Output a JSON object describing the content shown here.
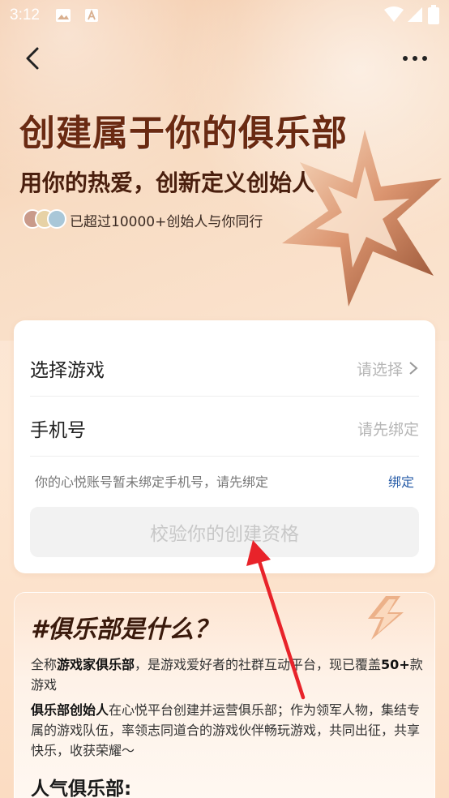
{
  "status_bar": {
    "time": "3:12"
  },
  "hero": {
    "title": "创建属于你的俱乐部",
    "subtitle": "用你的热爱，创新定义创始人",
    "founders_text": "已超过10000+创始人与你同行"
  },
  "form": {
    "game_label": "选择游戏",
    "game_placeholder": "请选择",
    "phone_label": "手机号",
    "phone_placeholder": "请先绑定",
    "hint": "你的心悦账号暂未绑定手机号，请先绑定",
    "bind_label": "绑定",
    "verify_label": "校验你的创建资格"
  },
  "info": {
    "title": "#俱乐部是什么？",
    "para1_prefix": "全称",
    "para1_bold1": "游戏家俱乐部",
    "para1_mid": "，是游戏爱好者的社群互动平台，现已覆盖",
    "para1_bold2": "50+",
    "para1_suffix": "款游戏",
    "para2_bold": "俱乐部创始人",
    "para2_text": "在心悦平台创建并运营俱乐部；作为领军人物，集结专属的游戏队伍，率领志同道合的游戏伙伴畅玩游戏，共同出征，共享快乐，收获荣耀～",
    "popular_title": "人气俱乐部:"
  },
  "colors": {
    "accent_link": "#2a5ea8",
    "title_brown": "#6a2a12",
    "annotation_arrow": "#e8232a"
  },
  "icons": [
    "back-icon",
    "more-icon",
    "chevron-right-icon",
    "lightning-icon",
    "star-emblem-icon",
    "image-icon",
    "a-icon",
    "wifi-icon",
    "signal-icon",
    "battery-icon"
  ]
}
